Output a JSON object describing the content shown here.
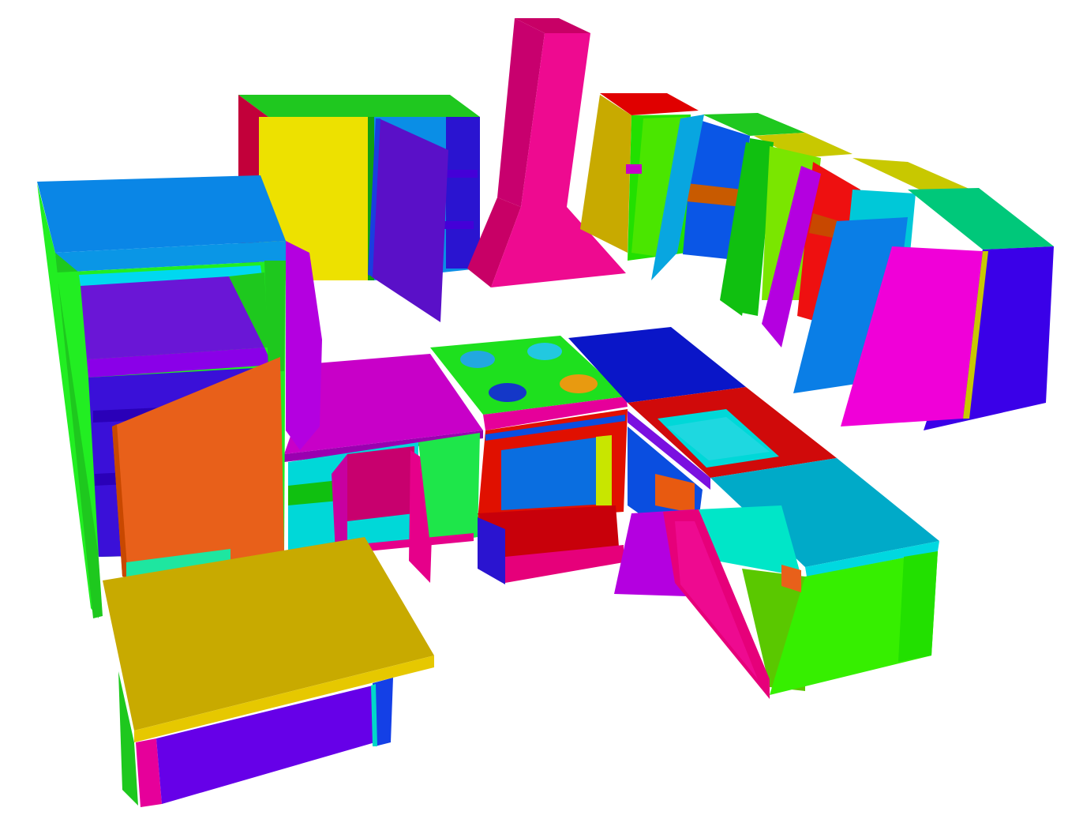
{
  "scene": {
    "background": "#ffffff",
    "palette": {
      "fridge_side": "#22ee22",
      "fridge_top": "#0a86e6",
      "fridge_inner": "#6a16d6",
      "fridge_door": "#e8601a",
      "upper_left_front": "#ede100",
      "upper_left_top": "#1fc81f",
      "upper_left_door": "#5a10c8",
      "hood": "#ee0a90",
      "counter_top": "#c800c8",
      "cooktop": "#1ee01e",
      "burner_blue": "#22a8e0",
      "burner_navy": "#1437c8",
      "burner_orange": "#e89a10",
      "oven_front": "#e01000",
      "oven_window": "#0a6ee0",
      "sink_frame": "#d00a0a",
      "sink_basin": "#00d8d8",
      "right_block_top": "#00aac8",
      "right_block_side": "#36ef00",
      "dishwasher_door": "#e6007a",
      "island_top": "#c8aa00",
      "island_front": "#6600e8",
      "right_uppers_top": "#c8c800",
      "right_uppers_side": "#3a00e8",
      "right_door_magenta": "#f000d8",
      "right_door_blue": "#0a7ee6"
    }
  }
}
